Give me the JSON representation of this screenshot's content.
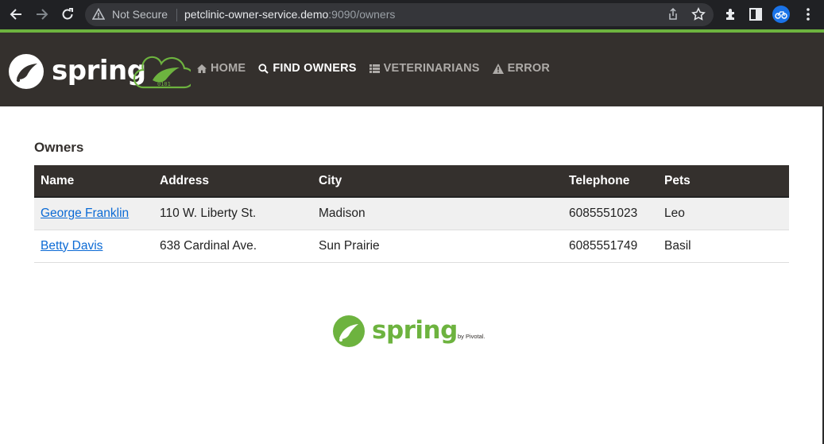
{
  "browser": {
    "security_label": "Not Secure",
    "url_host": "petclinic-owner-service.demo",
    "url_rest": ":9090/owners",
    "icons": [
      "back-icon",
      "forward-icon",
      "reload-icon",
      "warning-icon",
      "share-icon",
      "star-icon",
      "extensions-icon",
      "side-panel-icon",
      "menu-icon"
    ]
  },
  "header": {
    "logo_text": "spring",
    "badge_text": "0101",
    "nav": [
      {
        "label": "HOME",
        "icon": "home-icon",
        "active": false
      },
      {
        "label": "FIND OWNERS",
        "icon": "search-icon",
        "active": true
      },
      {
        "label": "VETERINARIANS",
        "icon": "list-icon",
        "active": false
      },
      {
        "label": "ERROR",
        "icon": "warning-icon",
        "active": false
      }
    ]
  },
  "main": {
    "title": "Owners",
    "columns": [
      "Name",
      "Address",
      "City",
      "Telephone",
      "Pets"
    ],
    "rows": [
      {
        "name": "George Franklin",
        "address": "110 W. Liberty St.",
        "city": "Madison",
        "telephone": "6085551023",
        "pets": "Leo"
      },
      {
        "name": "Betty Davis",
        "address": "638 Cardinal Ave.",
        "city": "Sun Prairie",
        "telephone": "6085551749",
        "pets": "Basil"
      }
    ]
  },
  "footer": {
    "logo_text": "spring",
    "by_text": "by Pivotal."
  },
  "colors": {
    "brand_green": "#6db33f",
    "header_bg": "#34302d",
    "link": "#0b6ad5"
  }
}
